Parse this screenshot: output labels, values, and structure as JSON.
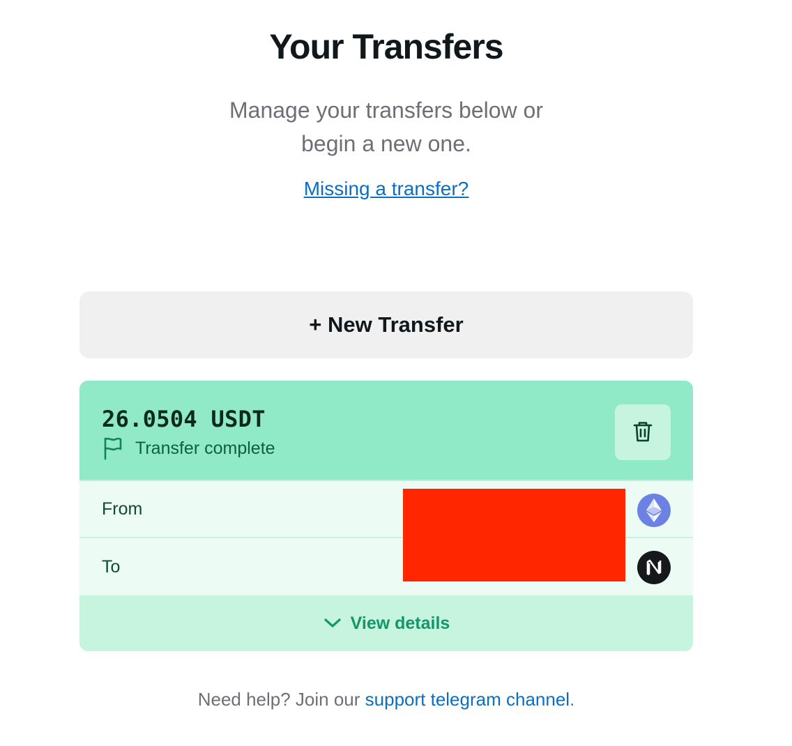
{
  "header": {
    "title": "Your Transfers",
    "subtitle_line1": "Manage your transfers below or",
    "subtitle_line2": "begin a new one.",
    "missing_link": "Missing a transfer?"
  },
  "actions": {
    "new_transfer": "+ New Transfer"
  },
  "transfer": {
    "amount": "26.0504 USDT",
    "status": "Transfer complete",
    "status_icon": "flag-icon",
    "delete_icon": "trash-icon",
    "from_label": "From",
    "from_chain_icon": "ethereum-icon",
    "to_label": "To",
    "to_chain_icon": "near-icon",
    "details_label": "View details",
    "details_icon": "chevron-down-icon"
  },
  "footer": {
    "help_prefix": "Need help? Join our ",
    "help_link": "support telegram channel",
    "help_suffix": "."
  },
  "colors": {
    "card_header": "#90eac7",
    "card_body": "#ecfbf4",
    "details_bar": "#c6f4df",
    "accent_green": "#13966a",
    "link_blue": "#0a6fc2",
    "redaction": "#ff2600"
  }
}
